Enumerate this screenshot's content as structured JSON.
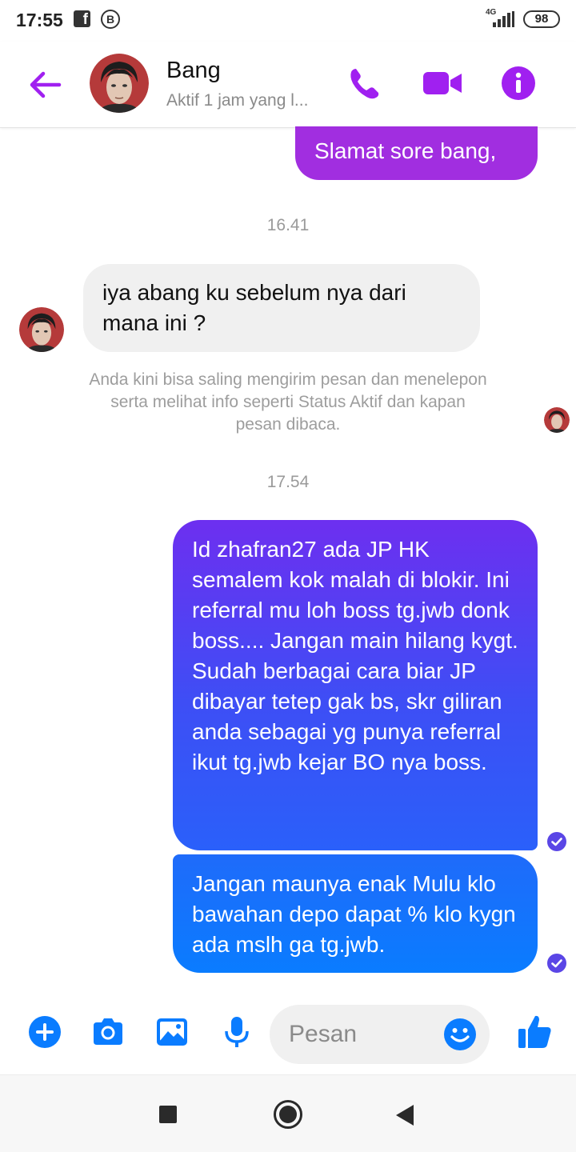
{
  "status_bar": {
    "time": "17:55",
    "fb_glyph": "f",
    "b_glyph": "B",
    "network": "4G",
    "battery": "98"
  },
  "header": {
    "contact_name": "Bang",
    "contact_status": "Aktif 1 jam yang l...",
    "accent_color": "#a020f0"
  },
  "messages": [
    {
      "direction": "outgoing",
      "text": "Slamat sore bang,"
    },
    {
      "type": "timestamp",
      "text": "16.41"
    },
    {
      "direction": "incoming",
      "text": "iya abang ku sebelum nya dari mana ini ?"
    },
    {
      "type": "system",
      "text": "Anda kini bisa saling mengirim pesan dan menelepon serta melihat info seperti Status Aktif dan kapan pesan dibaca."
    },
    {
      "type": "timestamp",
      "text": "17.54"
    },
    {
      "direction": "outgoing",
      "text": "Id zhafran27 ada JP HK semalem kok malah di blokir. Ini referral mu loh boss tg.jwb donk boss.... Jangan main hilang kygt. Sudah berbagai cara biar JP dibayar tetep gak bs, skr giliran anda sebagai yg punya referral ikut tg.jwb kejar BO nya boss.",
      "status": "read"
    },
    {
      "direction": "outgoing",
      "text": "Jangan maunya enak Mulu klo bawahan depo dapat % klo kygn ada mslh ga tg.jwb.",
      "status": "read"
    }
  ],
  "composer": {
    "placeholder": "Pesan",
    "icons": [
      "plus-icon",
      "camera-icon",
      "gallery-icon",
      "microphone-icon",
      "emoji-icon",
      "thumbs-up-icon"
    ],
    "icon_color": "#0a7cff"
  }
}
